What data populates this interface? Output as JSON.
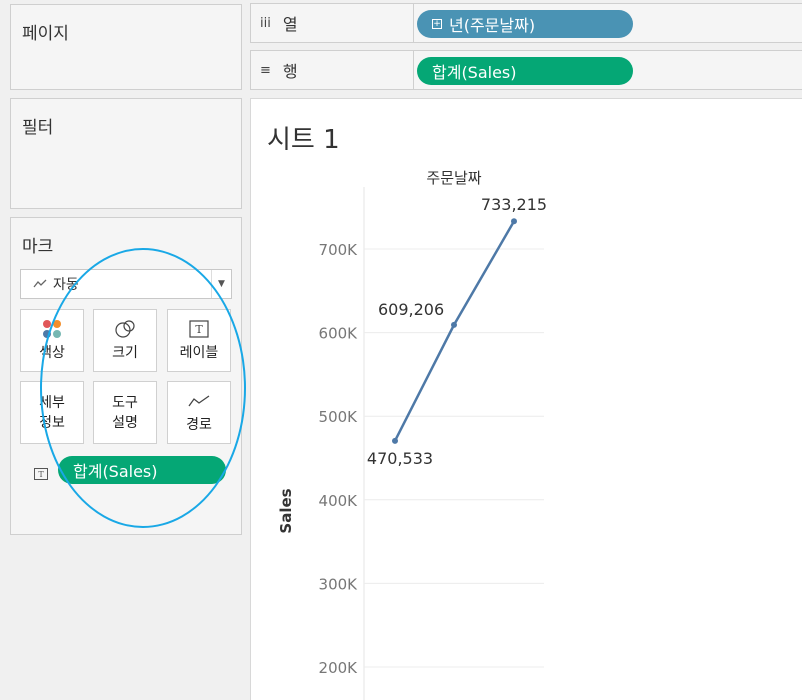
{
  "panels": {
    "pages_title": "페이지",
    "filters_title": "필터",
    "marks_title": "마크"
  },
  "shelves": {
    "columns": {
      "label": "열",
      "pill": "년(주문날짜)"
    },
    "rows": {
      "label": "행",
      "pill": "합계(Sales)"
    }
  },
  "marks": {
    "dropdown_value": "자동",
    "buttons": {
      "color": "색상",
      "size": "크기",
      "label": "레이블",
      "detail_line1": "세부",
      "detail_line2": "정보",
      "tooltip_line1": "도구",
      "tooltip_line2": "설명",
      "path": "경로"
    },
    "label_pill": "합계(Sales)"
  },
  "sheet": {
    "title": "시트 1"
  },
  "colors": {
    "pill_blue": "#4a93b4",
    "pill_green": "#05a775",
    "line": "#4e79a7",
    "annotation": "#19a8e6"
  },
  "chart_data": {
    "type": "line",
    "header": "주문날짜",
    "ylabel": "Sales",
    "ylim": [
      180000,
      790000
    ],
    "yticks": [
      {
        "value": 200000,
        "label": "200K"
      },
      {
        "value": 300000,
        "label": "300K"
      },
      {
        "value": 400000,
        "label": "400K"
      },
      {
        "value": 500000,
        "label": "500K"
      },
      {
        "value": 600000,
        "label": "600K"
      },
      {
        "value": 700000,
        "label": "700K"
      }
    ],
    "points": [
      {
        "value": 470533,
        "label": "470,533",
        "label_pos": "below"
      },
      {
        "value": 609206,
        "label": "609,206",
        "label_pos": "left"
      },
      {
        "value": 733215,
        "label": "733,215",
        "label_pos": "above"
      }
    ]
  }
}
